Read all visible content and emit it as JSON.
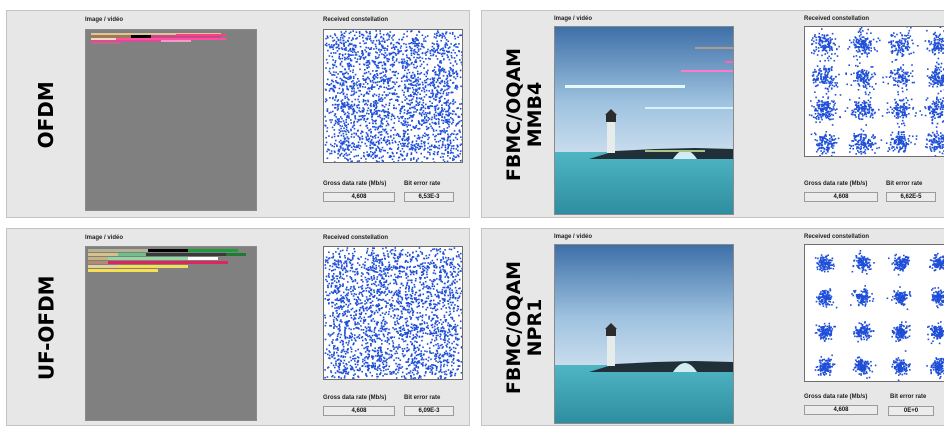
{
  "panels": [
    {
      "label_lines": [
        "OFDM"
      ],
      "image_label": "Image / vidéo",
      "constellation_label": "Received constellation",
      "rate_label": "Gross data rate (Mb/s)",
      "ber_label": "Bit error rate",
      "rate_value": "4,608",
      "ber_value": "6,53E-3"
    },
    {
      "label_lines": [
        "FBMC/OQAM",
        "MMB4"
      ],
      "image_label": "Image / vidéo",
      "constellation_label": "Received constellation",
      "rate_label": "Gross data rate (Mb/s)",
      "ber_label": "Bit error rate",
      "rate_value": "4,608",
      "ber_value": "6,62E-5"
    },
    {
      "label_lines": [
        "UF-OFDM"
      ],
      "image_label": "Image / vidéo",
      "constellation_label": "Received constellation",
      "rate_label": "Gross data rate (Mb/s)",
      "ber_label": "Bit error rate",
      "rate_value": "4,608",
      "ber_value": "6,09E-3"
    },
    {
      "label_lines": [
        "FBMC/OQAM",
        "NPR1"
      ],
      "image_label": "Image / vidéo",
      "constellation_label": "Received constellation",
      "rate_label": "Gross data rate (Mb/s)",
      "ber_label": "Bit error rate",
      "rate_value": "4,608",
      "ber_value": "0E+0"
    }
  ],
  "colors": {
    "panel_bg": "#e7e7e7",
    "corrupted_image_gray": "#808080",
    "constellation_points": "#1f4fd8",
    "sky_top": "#3d6fa8",
    "sea": "#3aa6b5"
  }
}
